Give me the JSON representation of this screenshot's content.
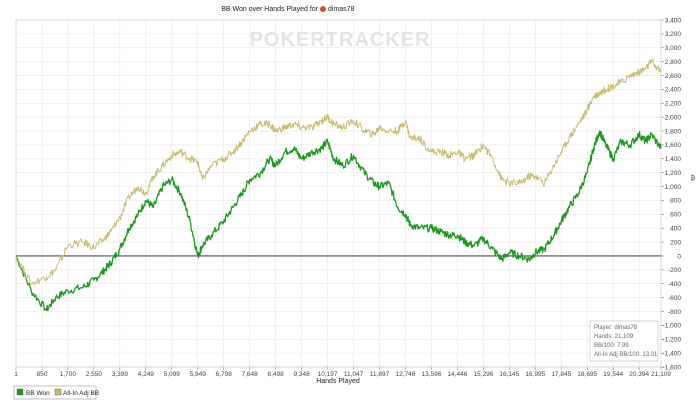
{
  "chart_data": {
    "type": "line",
    "title": "BB Won over Hands Played for",
    "player": "dimas78",
    "watermark": "POKERTRACKER",
    "xlabel": "Hands Played",
    "xlim": [
      1,
      21109
    ],
    "x_ticks": [
      "1",
      "850",
      "1,700",
      "2,550",
      "3,399",
      "4,249",
      "5,099",
      "5,949",
      "6,798",
      "7,648",
      "8,498",
      "9,348",
      "10,197",
      "11,047",
      "11,897",
      "12,746",
      "13,596",
      "14,446",
      "15,296",
      "16,145",
      "16,995",
      "17,845",
      "18,695",
      "19,544",
      "20,394",
      "21,109"
    ],
    "ylim": [
      -1600,
      3400
    ],
    "y_ticks": [
      "3,400",
      "3,200",
      "3,000",
      "2,800",
      "2,600",
      "2,400",
      "2,200",
      "2,000",
      "1,800",
      "1,600",
      "1,400",
      "1,200",
      "1,000",
      "800",
      "600",
      "400",
      "200",
      "0",
      "-200",
      "-400",
      "-600",
      "-800",
      "-1,000",
      "-1,200",
      "-1,400",
      "-1,600"
    ],
    "grid": true,
    "legend_position": "bottom-left",
    "series": [
      {
        "name": "BB Won",
        "color": "#1a9a1a",
        "x": [
          1,
          500,
          1000,
          1300,
          1700,
          2200,
          2550,
          2900,
          3100,
          3399,
          3700,
          4000,
          4249,
          4500,
          4800,
          5099,
          5400,
          5700,
          5949,
          6100,
          6400,
          6798,
          7100,
          7400,
          7648,
          8000,
          8300,
          8498,
          8800,
          9100,
          9348,
          9700,
          10000,
          10197,
          10400,
          10700,
          11047,
          11400,
          11700,
          11897,
          12200,
          12500,
          12746,
          12900,
          13200,
          13596,
          13900,
          14200,
          14446,
          14700,
          15000,
          15296,
          15600,
          15900,
          16145,
          16500,
          16800,
          16995,
          17300,
          17600,
          17845,
          18100,
          18400,
          18695,
          18900,
          19100,
          19300,
          19544,
          19800,
          20100,
          20394,
          20600,
          20800,
          21109
        ],
        "y": [
          0,
          -500,
          -780,
          -600,
          -500,
          -450,
          -350,
          -200,
          -100,
          100,
          400,
          600,
          800,
          700,
          1000,
          1100,
          900,
          500,
          0,
          150,
          300,
          500,
          700,
          900,
          1100,
          1200,
          1400,
          1300,
          1500,
          1550,
          1400,
          1500,
          1550,
          1650,
          1400,
          1300,
          1450,
          1200,
          1050,
          1000,
          1050,
          700,
          600,
          450,
          400,
          400,
          350,
          300,
          300,
          200,
          150,
          250,
          100,
          -50,
          50,
          0,
          -50,
          50,
          100,
          300,
          500,
          700,
          900,
          1200,
          1550,
          1800,
          1600,
          1400,
          1650,
          1600,
          1750,
          1650,
          1750,
          1550
        ]
      },
      {
        "name": "All-In Adj BB",
        "color": "#c8bc6a",
        "x": [
          1,
          500,
          1000,
          1300,
          1700,
          2200,
          2550,
          2900,
          3100,
          3399,
          3700,
          4000,
          4249,
          4500,
          4800,
          5099,
          5400,
          5700,
          5949,
          6100,
          6400,
          6798,
          7100,
          7400,
          7648,
          8000,
          8300,
          8498,
          8800,
          9100,
          9348,
          9700,
          10000,
          10197,
          10400,
          10700,
          11047,
          11400,
          11700,
          11897,
          12200,
          12500,
          12746,
          12900,
          13200,
          13596,
          13900,
          14200,
          14446,
          14700,
          15000,
          15296,
          15600,
          15900,
          16145,
          16500,
          16800,
          16995,
          17300,
          17600,
          17845,
          18100,
          18400,
          18695,
          18900,
          19100,
          19300,
          19544,
          19800,
          20100,
          20394,
          20600,
          20800,
          21109
        ],
        "y": [
          0,
          -400,
          -300,
          -200,
          150,
          200,
          120,
          250,
          350,
          550,
          850,
          1000,
          900,
          1150,
          1300,
          1450,
          1500,
          1400,
          1350,
          1100,
          1300,
          1400,
          1500,
          1650,
          1800,
          1900,
          1900,
          1800,
          1850,
          1900,
          1850,
          1850,
          1950,
          2000,
          1900,
          1850,
          1950,
          1800,
          1750,
          1850,
          1800,
          1800,
          1950,
          1700,
          1700,
          1500,
          1500,
          1450,
          1500,
          1400,
          1450,
          1600,
          1400,
          1100,
          1050,
          1050,
          1150,
          1150,
          1050,
          1300,
          1500,
          1700,
          1900,
          2100,
          2300,
          2350,
          2400,
          2450,
          2500,
          2600,
          2650,
          2700,
          2800,
          2650
        ]
      }
    ],
    "info_box": [
      "Player: dimas78",
      "Hands: 21,109",
      "BB/100: 7.99",
      "All-In Adj BB/100: 13.01"
    ]
  }
}
